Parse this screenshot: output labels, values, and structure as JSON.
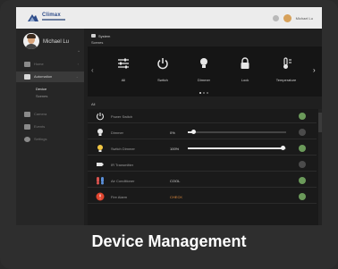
{
  "colors": {
    "accent": "#e08a3c",
    "toggle_on": "#6b9a5a",
    "screen_bg": "#1f1f1f",
    "caption": "#ffffff"
  },
  "topbar": {
    "brand": "Climax",
    "user_name": "Michael Lu"
  },
  "sidebar": {
    "profile_name": "Michael Lu",
    "items": [
      {
        "icon": "home-icon",
        "label": "Home"
      },
      {
        "icon": "automation-icon",
        "label": "Automation"
      },
      {
        "icon": "camera-icon",
        "label": "Camera"
      },
      {
        "icon": "list-icon",
        "label": "Events"
      },
      {
        "icon": "gear-icon",
        "label": "Settings"
      }
    ],
    "sub_items": [
      "Device",
      "Scenes"
    ]
  },
  "main": {
    "breadcrumb": "System",
    "scenes_label": "Scenes",
    "scenes": [
      {
        "icon": "sliders-icon",
        "label": "All"
      },
      {
        "icon": "power-icon",
        "label": "Switch"
      },
      {
        "icon": "bulb-icon",
        "label": "Dimmer"
      },
      {
        "icon": "lock-icon",
        "label": "Lock"
      },
      {
        "icon": "thermometer-icon",
        "label": "Temperature"
      }
    ],
    "list_label": "All",
    "devices": [
      {
        "icon": "power-icon",
        "name": "Power Switch",
        "value": ""
      },
      {
        "icon": "bulb-icon",
        "name": "Dimmer",
        "value": "0%",
        "level": 0.05
      },
      {
        "icon": "bulb-icon",
        "name": "Switch Dimmer",
        "value": "100%",
        "level": 1.0
      },
      {
        "icon": "thermostat-icon",
        "name": "IR Transmitter",
        "value": ""
      },
      {
        "icon": "thermometer-icon",
        "name": "Air Conditioner",
        "value": "COOL",
        "time": ""
      },
      {
        "icon": "alarm-icon",
        "name": "Fire Alarm",
        "value": "CHECK",
        "time": ""
      }
    ]
  },
  "caption": "Device Management"
}
